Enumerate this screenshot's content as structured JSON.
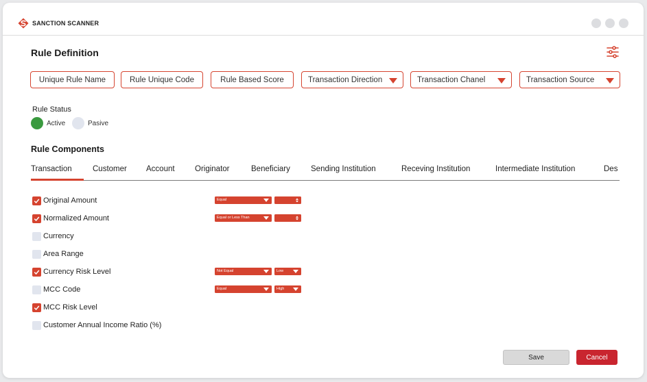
{
  "brand": {
    "name": "SANCTION SCANNER",
    "logo_icon": "sanction-scanner-logo-icon",
    "color": "#d5432f"
  },
  "page": {
    "title": "Rule Definition",
    "settings_icon": "sliders-icon"
  },
  "fields": [
    {
      "label": "Unique Rule Name",
      "type": "text"
    },
    {
      "label": "Rule Unique Code",
      "type": "text"
    },
    {
      "label": "Rule Based Score",
      "type": "text"
    },
    {
      "label": "Transaction Direction",
      "type": "dropdown"
    },
    {
      "label": "Transaction Chanel",
      "type": "dropdown"
    },
    {
      "label": "Transaction Source",
      "type": "dropdown"
    }
  ],
  "rule_status": {
    "label": "Rule Status",
    "options": [
      {
        "label": "Active",
        "selected": true,
        "color": "#3a9a3f"
      },
      {
        "label": "Pasive",
        "selected": false,
        "color": "#e1e5ee"
      }
    ]
  },
  "components": {
    "title": "Rule Components",
    "tabs": [
      "Transaction",
      "Customer",
      "Account",
      "Originator",
      "Beneficiary",
      "Sending Institution",
      "Receving Institution",
      "Intermediate Institution",
      "Des"
    ],
    "active_tab": "Transaction",
    "rows": [
      {
        "label": "Original Amount",
        "checked": true,
        "operator": "Equal",
        "value": "",
        "value_kind": "number"
      },
      {
        "label": "Normalized Amount",
        "checked": true,
        "operator": "Equal or Less Than",
        "value": "",
        "value_kind": "number"
      },
      {
        "label": "Currency",
        "checked": false
      },
      {
        "label": "Area Range",
        "checked": false
      },
      {
        "label": "Currency Risk Level",
        "checked": true,
        "operator": "Not Equal",
        "value": "Low",
        "value_kind": "select"
      },
      {
        "label": "MCC Code",
        "checked": false,
        "operator": "Equal",
        "value": "High",
        "value_kind": "select"
      },
      {
        "label": "MCC Risk Level",
        "checked": true
      },
      {
        "label": "Customer Annual Income Ratio (%)",
        "checked": false
      }
    ]
  },
  "actions": {
    "save_label": "Save",
    "cancel_label": "Cancel"
  },
  "colors": {
    "accent": "#d5432f",
    "cancel": "#c9252f",
    "active_green": "#3a9a3f"
  }
}
